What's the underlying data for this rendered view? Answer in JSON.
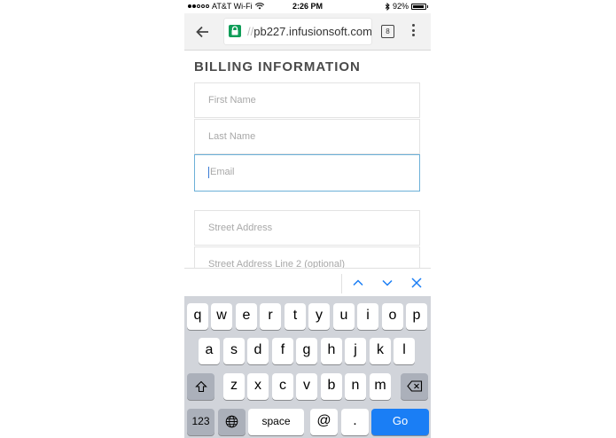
{
  "status_bar": {
    "carrier": "AT&T Wi-Fi",
    "time": "2:26 PM",
    "battery": "92%",
    "battery_level": 0.92,
    "signal_bars": 2
  },
  "browser": {
    "url_prefix": "//",
    "url": "pb227.infusionsoft.com",
    "tab_count": "8",
    "icons": [
      "back-arrow-icon",
      "lock-icon",
      "tabs-icon",
      "overflow-menu-icon"
    ]
  },
  "form": {
    "heading": "BILLING INFORMATION",
    "fields": {
      "first_name": "First Name",
      "last_name": "Last Name",
      "email": "Email",
      "street": "Street Address",
      "street2": "Street Address Line 2 (optional)"
    }
  },
  "colors": {
    "focus_border": "#6cb0d8",
    "go_key": "#1a7ef5",
    "lock_green": "#0f9d58"
  },
  "keyboard": {
    "row1": [
      "q",
      "w",
      "e",
      "r",
      "t",
      "y",
      "u",
      "i",
      "o",
      "p"
    ],
    "row2": [
      "a",
      "s",
      "d",
      "f",
      "g",
      "h",
      "j",
      "k",
      "l"
    ],
    "row3": [
      "z",
      "x",
      "c",
      "v",
      "b",
      "n",
      "m"
    ],
    "numbers": "123",
    "space": "space",
    "at": "@",
    "dot": ".",
    "go": "Go"
  }
}
